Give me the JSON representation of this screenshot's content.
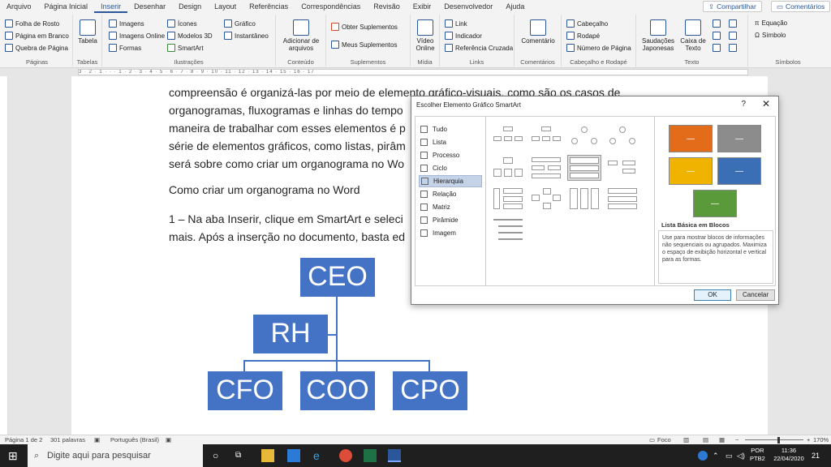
{
  "menu": {
    "tabs": [
      "Arquivo",
      "Página Inicial",
      "Inserir",
      "Desenhar",
      "Design",
      "Layout",
      "Referências",
      "Correspondências",
      "Revisão",
      "Exibir",
      "Desenvolvedor",
      "Ajuda"
    ],
    "active": "Inserir",
    "share": "Compartilhar",
    "comments": "Comentários"
  },
  "ribbon": {
    "paginas": {
      "label": "Páginas",
      "items": [
        "Folha de Rosto",
        "Página em Branco",
        "Quebra de Página"
      ]
    },
    "tabelas": {
      "label": "Tabelas",
      "button": "Tabela"
    },
    "ilustracoes": {
      "label": "Ilustrações",
      "items": [
        "Imagens",
        "Imagens Online",
        "Formas",
        "Ícones",
        "Modelos 3D",
        "SmartArt",
        "Gráfico",
        "Instantâneo"
      ]
    },
    "conteudo": {
      "label": "Conteúdo",
      "button": "Adicionar de arquivos"
    },
    "suplementos": {
      "label": "Suplementos",
      "items": [
        "Obter Suplementos",
        "Meus Suplementos"
      ]
    },
    "midia": {
      "label": "Mídia",
      "button": "Vídeo Online"
    },
    "links": {
      "label": "Links",
      "items": [
        "Link",
        "Indicador",
        "Referência Cruzada"
      ]
    },
    "comentarios": {
      "label": "Comentários",
      "button": "Comentário"
    },
    "cabecalho": {
      "label": "Cabeçalho e Rodapé",
      "items": [
        "Cabeçalho",
        "Rodapé",
        "Número de Página"
      ]
    },
    "texto": {
      "label": "Texto",
      "items": [
        "Saudações Japonesas",
        "Caixa de Texto"
      ]
    },
    "simbolos": {
      "label": "Símbolos",
      "items": [
        "Equação",
        "Símbolo"
      ]
    }
  },
  "ruler": {
    "marks": "3 · 2 · 1 · · · 1 · 2 · 3 · 4 · 5 · 6 · 7 · 8 · 9 · 10 · 11 · 12 · 13 · 14 · 15 · 16 · 17"
  },
  "document": {
    "lines": [
      "compreensão é organizá-las por meio de elemento gráfico-visuais, como são os casos de",
      "organogramas, fluxogramas e linhas do tempo",
      "maneira de trabalhar com esses elementos é p",
      "série de elementos gráficos, como listas, pirâm",
      "será sobre como criar um organograma no Wo"
    ],
    "heading": "Como criar um organograma no Word",
    "step_line1": "1 – Na aba Inserir, clique em SmartArt e seleci",
    "step_line2": "mais. Após a inserção no documento, basta ed",
    "org": {
      "top": "CEO",
      "assistant": "RH",
      "children": [
        "CFO",
        "COO",
        "CPO"
      ]
    }
  },
  "dialog": {
    "title": "Escolher Elemento Gráfico SmartArt",
    "help": "?",
    "close": "✕",
    "categories": [
      "Tudo",
      "Lista",
      "Processo",
      "Ciclo",
      "Hierarquia",
      "Relação",
      "Matriz",
      "Pirâmide",
      "Imagem"
    ],
    "selected_category": "Hierarquia",
    "preview_name": "Lista Básica em Blocos",
    "preview_desc": "Use para mostrar blocos de informações não sequenciais ou agrupados. Maximiza o espaço de exibição horizontal e vertical para as formas.",
    "ok": "OK",
    "cancel": "Cancelar",
    "block_colors": [
      "#e36c1a",
      "#8c8c8c",
      "#f0b400",
      "#3a6fb5",
      "#5a9a3a"
    ]
  },
  "status": {
    "page": "Página 1 de 2",
    "words": "301 palavras",
    "lang": "Português (Brasil)",
    "focus": "Foco",
    "zoom": "170%"
  },
  "taskbar": {
    "search": "Digite aqui para pesquisar",
    "lang": "POR",
    "kbd": "PTB2",
    "time": "11:36",
    "date": "22/04/2020",
    "notif": "21"
  }
}
